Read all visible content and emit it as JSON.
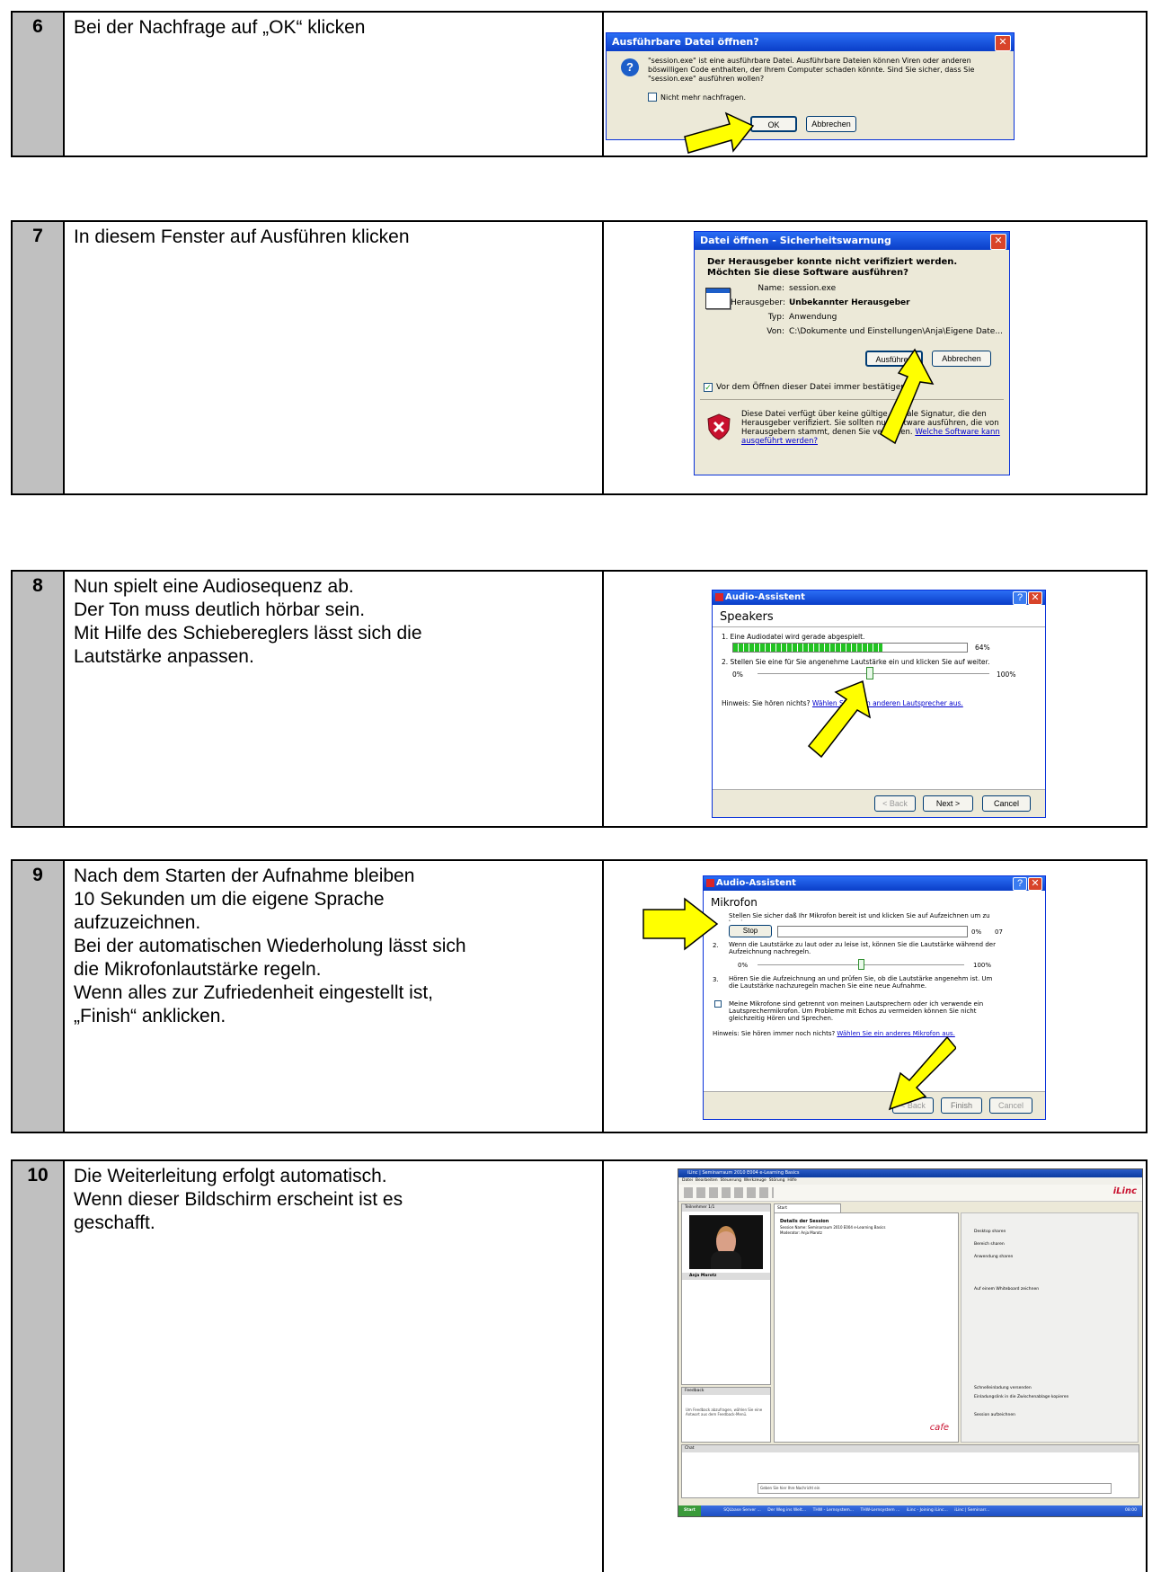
{
  "steps": [
    {
      "number": "6",
      "lines": [
        "Bei der Nachfrage auf „OK“ klicken"
      ],
      "dialog": {
        "title": "Ausführbare Datei öffnen?",
        "message": "\"session.exe\" ist eine ausführbare Datei. Ausführbare Dateien können Viren oder anderen böswilligen Code enthalten, der Ihrem Computer schaden könnte. Sind Sie sicher, dass Sie \"session.exe\" ausführen wollen?",
        "checkbox": "Nicht mehr nachfragen.",
        "ok": "OK",
        "cancel": "Abbrechen"
      }
    },
    {
      "number": "7",
      "lines": [
        "In diesem Fenster auf Ausführen klicken"
      ],
      "dialog": {
        "title": "Datei öffnen - Sicherheitswarnung",
        "question": "Der Herausgeber konnte nicht verifiziert werden. Möchten Sie diese Software ausführen?",
        "name_label": "Name:",
        "name_value": "session.exe",
        "publisher_label": "Herausgeber:",
        "publisher_value": "Unbekannter Herausgeber",
        "type_label": "Typ:",
        "type_value": "Anwendung",
        "from_label": "Von:",
        "from_value": "C:\\Dokumente und Einstellungen\\Anja\\Eigene Date...",
        "run": "Ausführen",
        "cancel": "Abbrechen",
        "checkbox": "Vor dem Öffnen dieser Datei immer bestätigen",
        "warning": "Diese Datei verfügt über keine gültige digitale Signatur, die den Herausgeber verifiziert. Sie sollten nur Software ausführen, die von Herausgebern stammt, denen Sie vertrauen.",
        "warning_link": "Welche Software kann ausgeführt werden?"
      }
    },
    {
      "number": "8",
      "lines": [
        "Nun spielt eine Audiosequenz ab.",
        "Der Ton muss deutlich hörbar sein.",
        "Mit Hilfe des Schiebereglers lässt sich die",
        "Lautstärke anpassen."
      ],
      "dialog": {
        "title": "Audio-Assistent",
        "heading": "Speakers",
        "item1": "1.  Eine Audiodatei wird gerade abgespielt.",
        "progress_label": "64%",
        "progress_fraction": 0.64,
        "item2": "2.  Stellen Sie eine für Sie angenehme Lautstärke ein und klicken Sie auf weiter.",
        "min": "0%",
        "max": "100%",
        "slider_fraction": 0.48,
        "hint": "Hinweis:  Sie hören nichts?",
        "hint_link": "Wählen Sie einen anderen Lautsprecher aus.",
        "back": "< Back",
        "next": "Next >",
        "cancel": "Cancel"
      }
    },
    {
      "number": "9",
      "lines": [
        "Nach dem Starten der Aufnahme bleiben",
        "10 Sekunden um die eigene Sprache",
        "aufzuzeichnen.",
        "Bei der automatischen Wiederholung lässt sich",
        "die Mikrofonlautstärke regeln.",
        "Wenn alles zur Zufriedenheit eingestellt ist,",
        "„Finish“ anklicken."
      ],
      "dialog": {
        "title": "Audio-Assistent",
        "heading": "Mikrofon",
        "item1": "Stellen Sie sicher daß Ihr Mikrofon bereit ist und klicken Sie auf Aufzeichnen um zu beginnen.",
        "stop": "Stop",
        "level_min": "0%",
        "level_time": "07",
        "item2": "Wenn die Lautstärke zu laut oder zu leise ist, können Sie die Lautstärke während der Aufzeichnung nachregeln.",
        "min": "0%",
        "max": "100%",
        "slider_fraction": 0.5,
        "item3": "Hören Sie die Aufzeichnung an und prüfen Sie, ob die Lautstärke angenehm ist. Um die Lautstärke nachzuregeln machen Sie eine neue Aufnahme.",
        "num2": "2.",
        "num3": "3.",
        "checkbox": "Meine Mikrofone sind getrennt von meinen Lautsprechern oder ich verwende ein Lautsprechermikrofon. Um Probleme mit Echos zu vermeiden können Sie nicht gleichzeitig Hören und Sprechen.",
        "hint": "Hinweis:  Sie hören immer noch nichts?",
        "hint_link": "Wählen Sie ein anderes Mikrofon aus.",
        "back": "< Back",
        "finish": "Finish",
        "cancel": "Cancel"
      }
    },
    {
      "number": "10",
      "lines": [
        "Die Weiterleitung erfolgt automatisch.",
        "Wenn dieser Bildschirm erscheint ist es",
        "geschafft."
      ],
      "app": {
        "title": "iLinc | Seminarraum 2010 E004 e-Learning Basics",
        "menu": [
          "Datei",
          "Bearbeiten",
          "Steuerung",
          "Werkzeuge",
          "Störung",
          "Hilfe"
        ],
        "brand": "iLinc",
        "participants_label": "Teilnehmer",
        "participants_count": "1/1",
        "user_name": "Anja Marotz",
        "tab_start": "Start",
        "details_title": "Details der Session",
        "session_name": "Session Name: Seminarraum 2010 E004 e-Learning Basics",
        "moderator": "Moderator: Anja Marotz",
        "actions": [
          "Desktop sharen",
          "Bereich sharen",
          "Anwendung sharen",
          "Auf einem Whiteboard zeichnen"
        ],
        "actions2": [
          "Schnelleinladung versenden",
          "Einladungslink in die Zwischenablage kopieren"
        ],
        "end_session": "Session aufzeichnen",
        "feedback_label": "Feedback",
        "feedback_text": "Um Feedback abzufragen, wählen Sie eine Antwort aus dem Feedback-Menü.",
        "chat_label": "Chat",
        "chat_placeholder": "Geben Sie hier Ihre Nachricht ein",
        "taskbar_start": "Start",
        "taskbar_items": [
          "SQLbase Server ...",
          "Der Weg ins Welt...",
          "THW - Lernsystem...",
          "THW-Lernsystem ...",
          "iLinc - Joining iLinc...",
          "iLinc | Seminarr..."
        ],
        "clock": "08:00",
        "logo_text": "cafe"
      }
    }
  ],
  "colors": {
    "accent_arrow": "#ffff00",
    "number_cell": "#c0c0c0",
    "xp_blue": "#0a3ec8"
  }
}
